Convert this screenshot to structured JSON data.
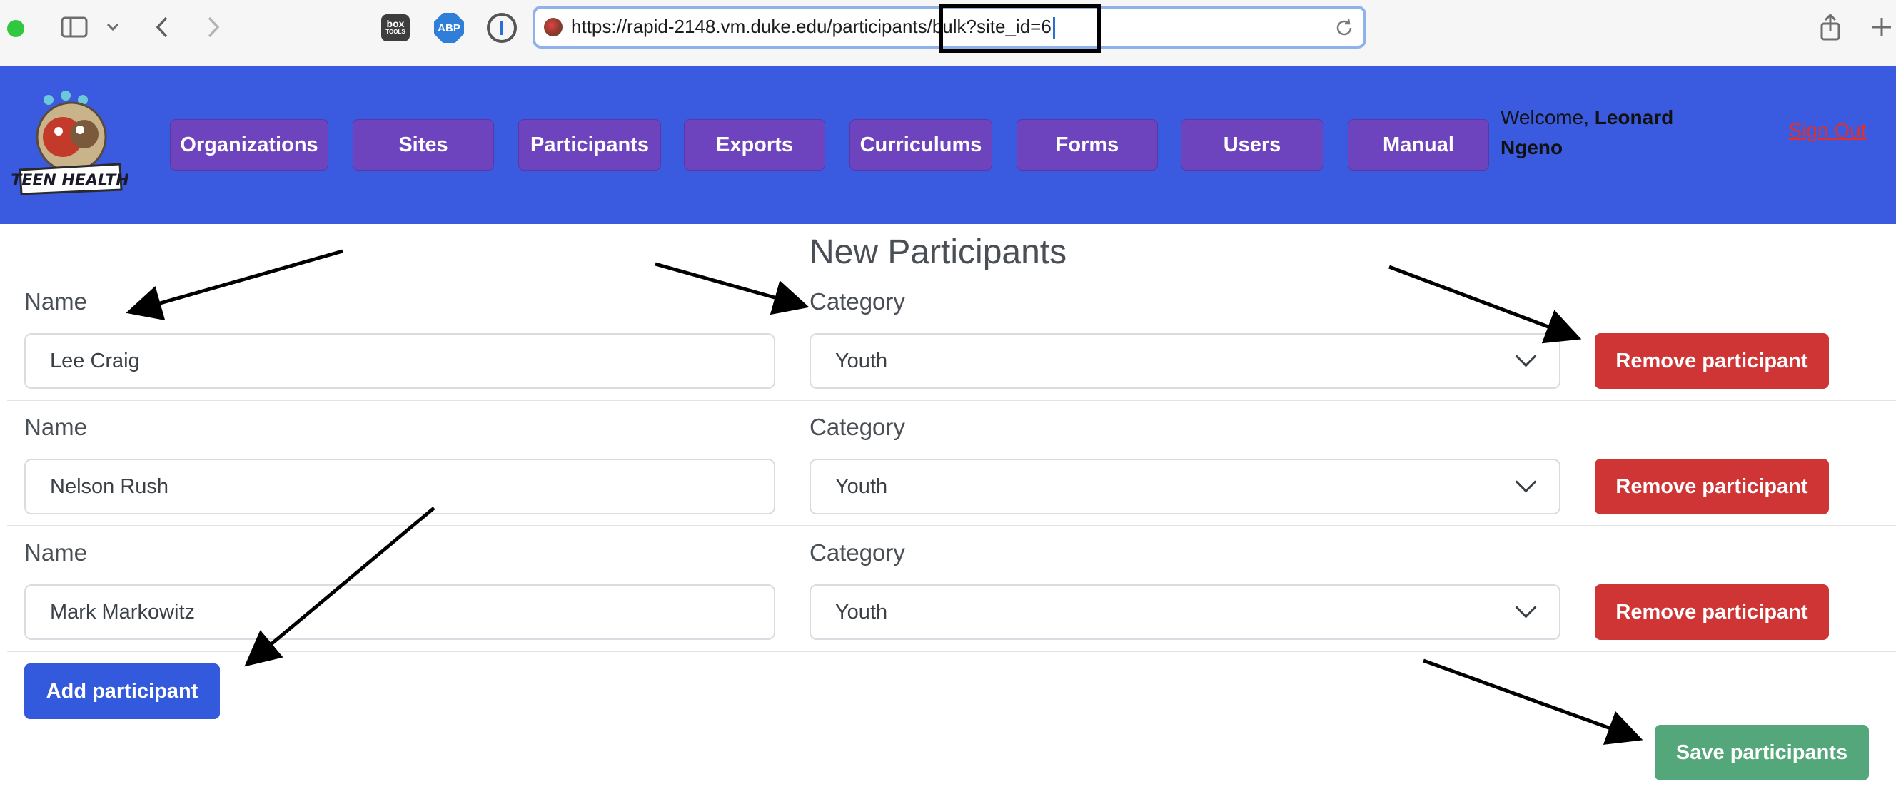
{
  "browser": {
    "url": "https://rapid-2148.vm.duke.edu/participants/bulk?site_id=6",
    "extensions": {
      "box_label_top": "box",
      "box_label_bottom": "TOOLS",
      "abp_label": "ABP"
    }
  },
  "header": {
    "logo_text": "TEEN HEALTH",
    "nav": [
      "Organizations",
      "Sites",
      "Participants",
      "Exports",
      "Curriculums",
      "Forms",
      "Users",
      "Manual"
    ],
    "welcome_prefix": "Welcome, ",
    "welcome_name": "Leonard Ngeno",
    "signout_label": "Sign Out"
  },
  "main": {
    "title": "New Participants",
    "name_label": "Name",
    "category_label": "Category",
    "remove_label": "Remove participant",
    "participants": [
      {
        "name": "Lee Craig",
        "category": "Youth"
      },
      {
        "name": "Nelson Rush",
        "category": "Youth"
      },
      {
        "name": "Mark Markowitz",
        "category": "Youth"
      }
    ],
    "add_label": "Add participant",
    "save_label": "Save participants"
  },
  "colors": {
    "header_bg": "#3a5bdf",
    "nav_bg": "#6d44bd",
    "remove_bg": "#cf3535",
    "add_bg": "#3359dc",
    "save_bg": "#54a77a",
    "signout": "#e02f2f"
  }
}
